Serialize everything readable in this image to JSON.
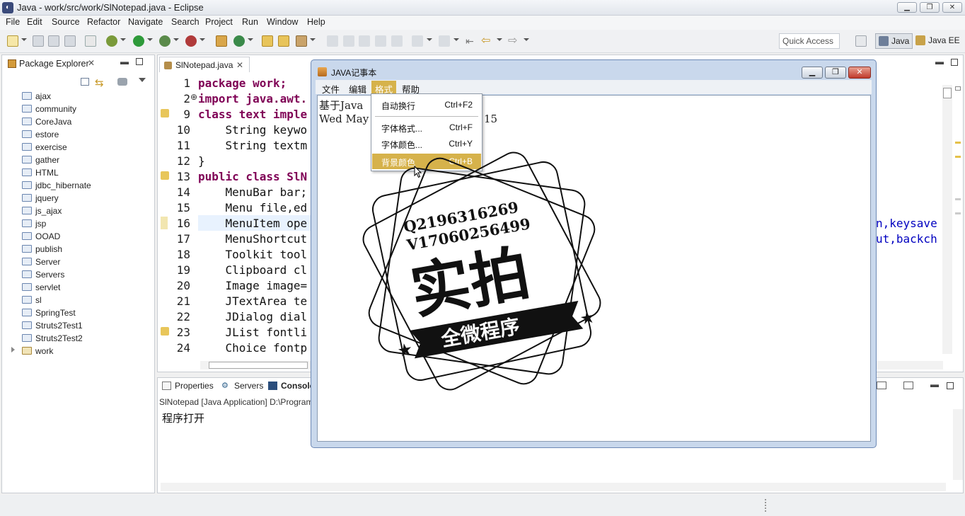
{
  "window": {
    "title": "Java - work/src/work/SlNotepad.java - Eclipse"
  },
  "menubar": [
    "File",
    "Edit",
    "Source",
    "Refactor",
    "Navigate",
    "Search",
    "Project",
    "Run",
    "Window",
    "Help"
  ],
  "toolbar": {
    "quick_access": "Quick Access",
    "perspectives": [
      "Java",
      "Java EE"
    ]
  },
  "package_explorer": {
    "title": "Package Explorer",
    "projects": [
      "ajax",
      "community",
      "CoreJava",
      "estore",
      "exercise",
      "gather",
      "HTML",
      "jdbc_hibernate",
      "jquery",
      "js_ajax",
      "jsp",
      "OOAD",
      "publish",
      "Server",
      "Servers",
      "servlet",
      "sl",
      "SpringTest",
      "Struts2Test1",
      "Struts2Test2",
      "work"
    ]
  },
  "editor": {
    "tab": "SlNotepad.java",
    "line_numbers": [
      "1",
      "2",
      "9",
      "10",
      "11",
      "12",
      "13",
      "14",
      "15",
      "16",
      "17",
      "18",
      "19",
      "20",
      "21",
      "22",
      "23",
      "24"
    ],
    "lines": [
      "package work;",
      "import java.awt.",
      "class text imple",
      "    String keywo",
      "    String textm",
      "}",
      "public class SlN",
      "    MenuBar bar;",
      "    Menu file,ed",
      "    MenuItem ope",
      "    MenuShortcut",
      "    Toolkit tool",
      "    Clipboard cl",
      "    Image image=",
      "    JTextArea te",
      "    JDialog dial",
      "    JList fontli",
      "    Choice fontp"
    ],
    "right_overflow": [
      "n,keysave",
      "ut,backch"
    ]
  },
  "bottom_panel": {
    "tabs": [
      "Properties",
      "Servers",
      "Console"
    ],
    "console_header": "SlNotepad [Java Application] D:\\Program",
    "console_output": "程序打开"
  },
  "dialog": {
    "title": "JAVA记事本",
    "menu": [
      "文件",
      "编辑",
      "格式",
      "帮助"
    ],
    "text_lines": [
      "基于Java",
      "Wed May "
    ],
    "text_tail": "15",
    "popup": [
      {
        "label": "自动换行",
        "shortcut": "Ctrl+F2"
      },
      {
        "label": "字体格式...",
        "shortcut": "Ctrl+F"
      },
      {
        "label": "字体颜色...",
        "shortcut": "Ctrl+Y"
      },
      {
        "label": "背景颜色",
        "shortcut": "Ctrl+B"
      }
    ]
  },
  "watermark": {
    "line1": "Q2196316269",
    "line2": "V17060256499",
    "main": "实拍",
    "ribbon": "全微程序"
  }
}
